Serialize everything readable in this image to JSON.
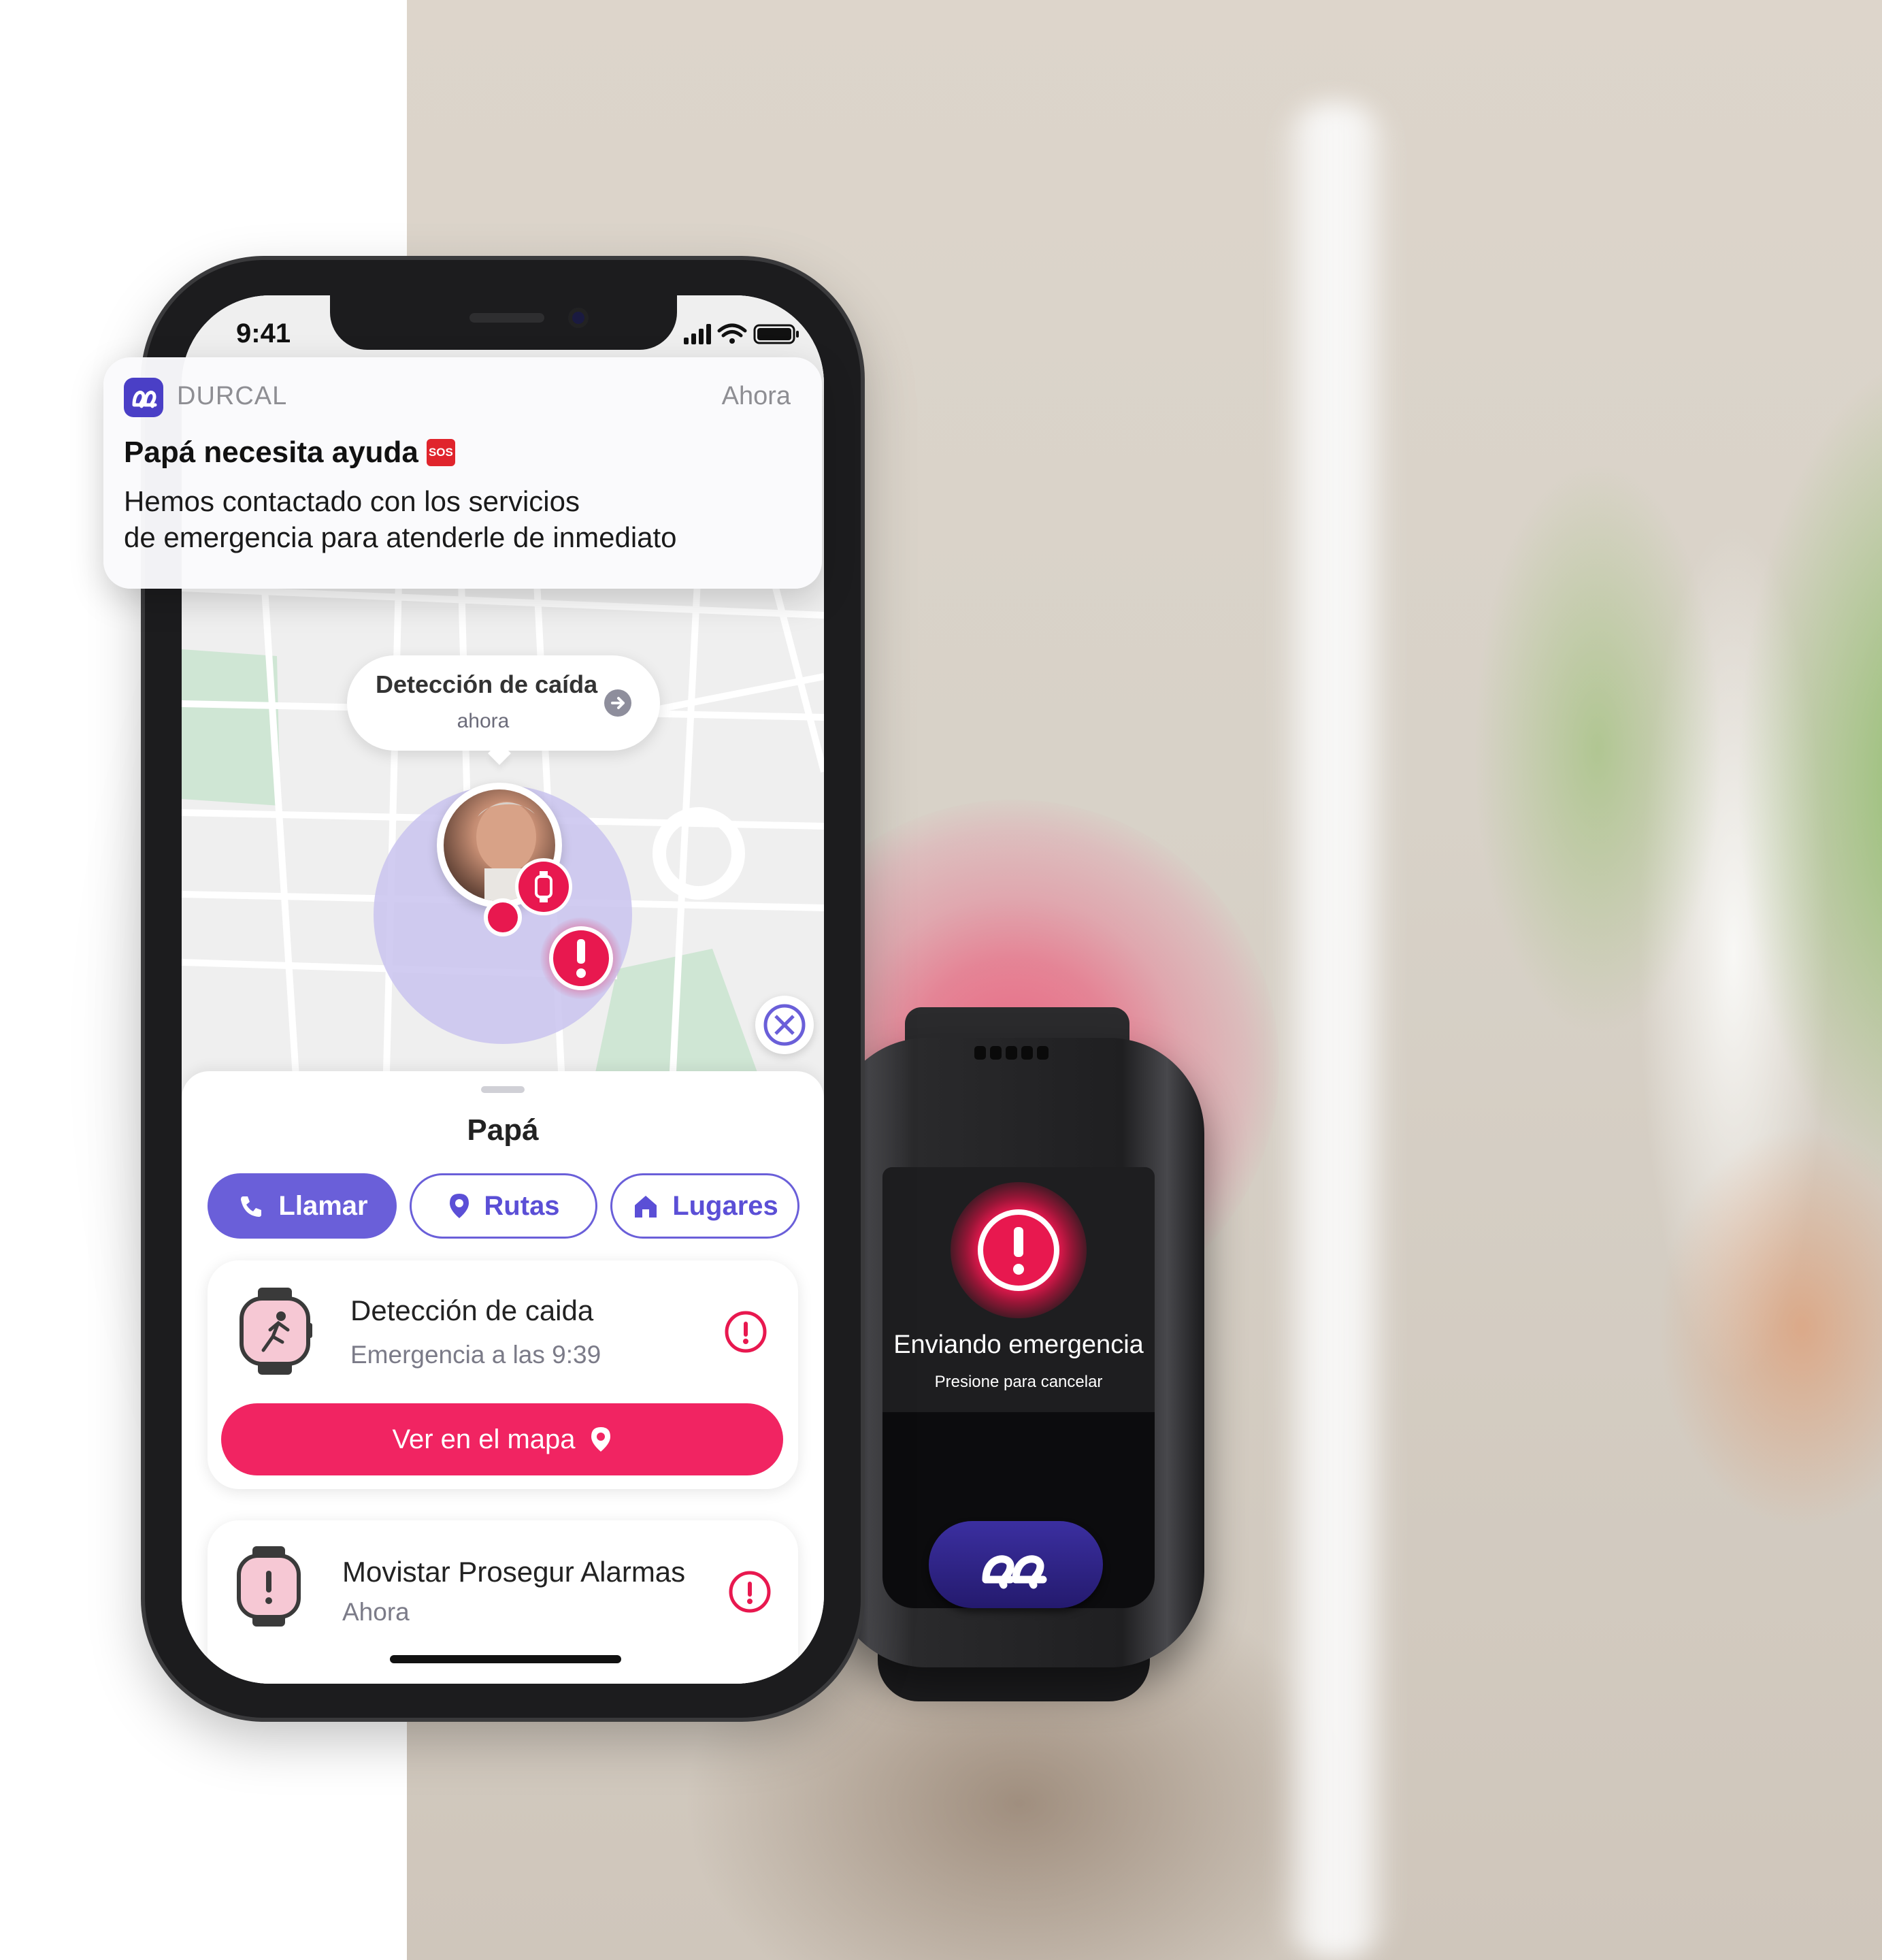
{
  "status_bar": {
    "time": "9:41"
  },
  "notification": {
    "app_name": "DURCAL",
    "time": "Ahora",
    "title": "Papá necesita ayuda",
    "sos_badge": "SOS",
    "body_line1": "Hemos contactado con los servicios",
    "body_line2": "de emergencia para atenderle de inmediato"
  },
  "map": {
    "callout_title": "Detección de caída",
    "callout_time": "ahora"
  },
  "sheet": {
    "title": "Papá",
    "buttons": {
      "call": "Llamar",
      "routes": "Rutas",
      "places": "Lugares"
    },
    "cards": [
      {
        "title": "Detección de caida",
        "subtitle": "Emergencia a las 9:39",
        "action": "Ver en el mapa"
      },
      {
        "title": "Movistar Prosegur Alarmas",
        "subtitle": "Ahora"
      }
    ]
  },
  "watch": {
    "main_text": "Enviando emergencia",
    "sub_text": "Presione para cancelar"
  },
  "colors": {
    "accent_purple": "#6a5fd9",
    "alert_pink": "#f12462",
    "brand_dark": "#4a3fc6"
  }
}
